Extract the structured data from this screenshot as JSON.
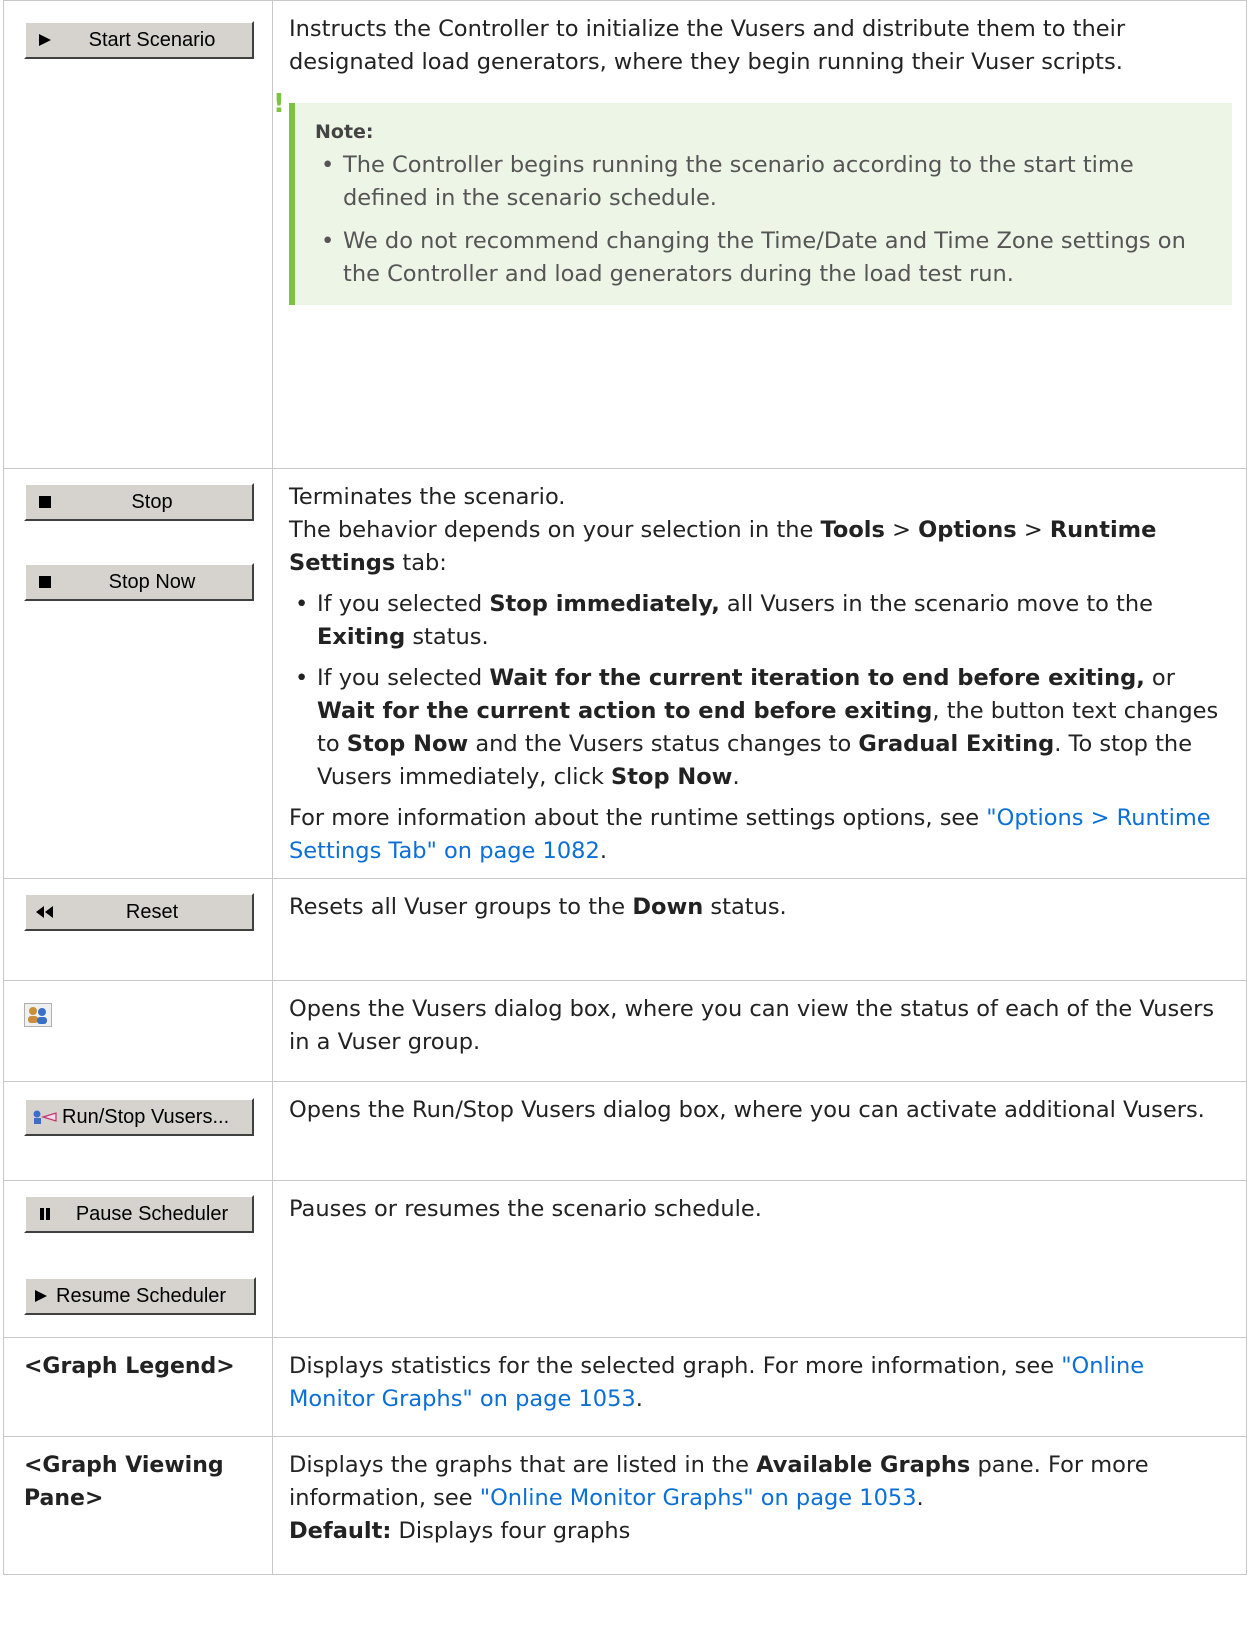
{
  "rows": [
    {
      "buttons": [
        {
          "label": "Start Scenario",
          "icon": "play-icon"
        }
      ],
      "desc": "Instructs the Controller to initialize the Vusers and distribute them to their designated load generators, where they begin running their Vuser scripts.",
      "note": {
        "title": "Note:",
        "items": [
          "The Controller begins running the scenario according to the start time defined in the scenario schedule.",
          "We do not recommend changing the Time/Date and Time Zone settings on the Controller and load generators during the load test run."
        ]
      }
    },
    {
      "buttons": [
        {
          "label": "Stop",
          "icon": "stop-icon"
        },
        {
          "label": "Stop Now",
          "icon": "stop-icon"
        }
      ],
      "line1": "Terminates the scenario.",
      "line2": {
        "a": "The behavior depends on your selection in the ",
        "b1": "Tools",
        "s1": " > ",
        "b2": "Options",
        "s2": " > ",
        "b3": "Runtime Settings",
        "c": " tab:"
      },
      "bullet1": {
        "a": "If you selected ",
        "b1": "Stop immediately,",
        "m": " all Vusers in the scenario move to the ",
        "b2": "Exiting",
        "c": " status."
      },
      "bullet2": {
        "a": "If you selected ",
        "b1": "Wait for the current iteration to end before exiting,",
        "m1": " or ",
        "b2": "Wait for the current action to end before exiting",
        "m2": ", the button text changes to ",
        "b3": "Stop Now",
        "m3": " and the Vusers status changes to ",
        "b4": "Gradual Exiting",
        "m4": ". To stop the Vusers immediately, click ",
        "b5": "Stop Now",
        "c": "."
      },
      "more": {
        "a": "For more information about the runtime settings options, see ",
        "link": "\"Options > Runtime Settings Tab\" on page 1082",
        "c": "."
      }
    },
    {
      "buttons": [
        {
          "label": "Reset",
          "icon": "rewind-icon"
        }
      ],
      "desc": {
        "a": "Resets all Vuser groups to the ",
        "b": "Down",
        "c": " status."
      }
    },
    {
      "icon": "vusers-icon",
      "desc": "Opens the Vusers dialog box, where you can view the status of each of the Vusers in a Vuser group."
    },
    {
      "buttons": [
        {
          "label": "Run/Stop Vusers...",
          "icon": "run-stop-vusers-icon"
        }
      ],
      "desc": "Opens the Run/Stop Vusers dialog box, where you can activate additional Vusers."
    },
    {
      "buttons": [
        {
          "label": "Pause Scheduler",
          "icon": "pause-icon"
        },
        {
          "label": "Resume Scheduler",
          "icon": "play-icon"
        }
      ],
      "desc": "Pauses or resumes the scenario schedule."
    },
    {
      "label": "<Graph Legend>",
      "desc": {
        "a": "Displays statistics for the selected graph. For more information, see ",
        "link": "\"Online Monitor Graphs\" on page 1053",
        "c": "."
      }
    },
    {
      "label": "<Graph Viewing Pane>",
      "desc": {
        "a": "Displays the graphs that are listed in the ",
        "b": "Available Graphs",
        "m": " pane. For more information, see ",
        "link": "\"Online Monitor Graphs\" on page 1053",
        "c": "."
      },
      "default": {
        "b": "Default:",
        "c": " Displays four graphs"
      }
    }
  ]
}
